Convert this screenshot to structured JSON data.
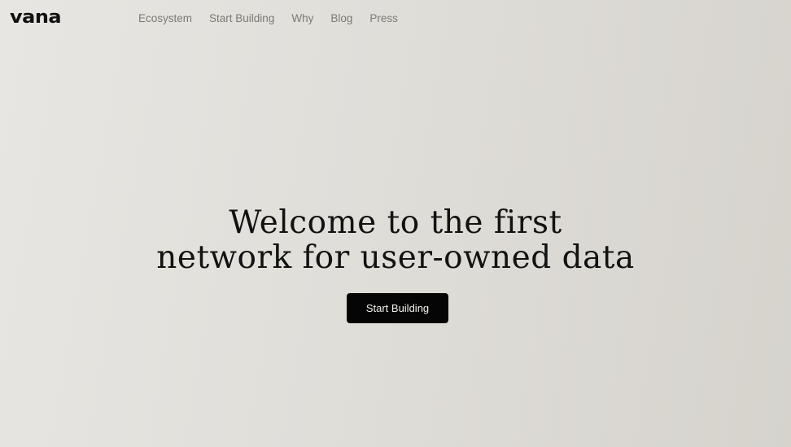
{
  "brand": {
    "logo_text": "vana"
  },
  "nav": {
    "items": [
      {
        "label": "Ecosystem"
      },
      {
        "label": "Start Building"
      },
      {
        "label": "Why"
      },
      {
        "label": "Blog"
      },
      {
        "label": "Press"
      }
    ]
  },
  "hero": {
    "title_line1": "Welcome to the first",
    "title_line2": "network for user-owned data",
    "cta_label": "Start Building"
  },
  "colors": {
    "background": "#e3e1dc",
    "text": "#121212",
    "nav_text": "#7b7974",
    "button_bg": "#050505",
    "button_text": "#f3f1ec"
  }
}
